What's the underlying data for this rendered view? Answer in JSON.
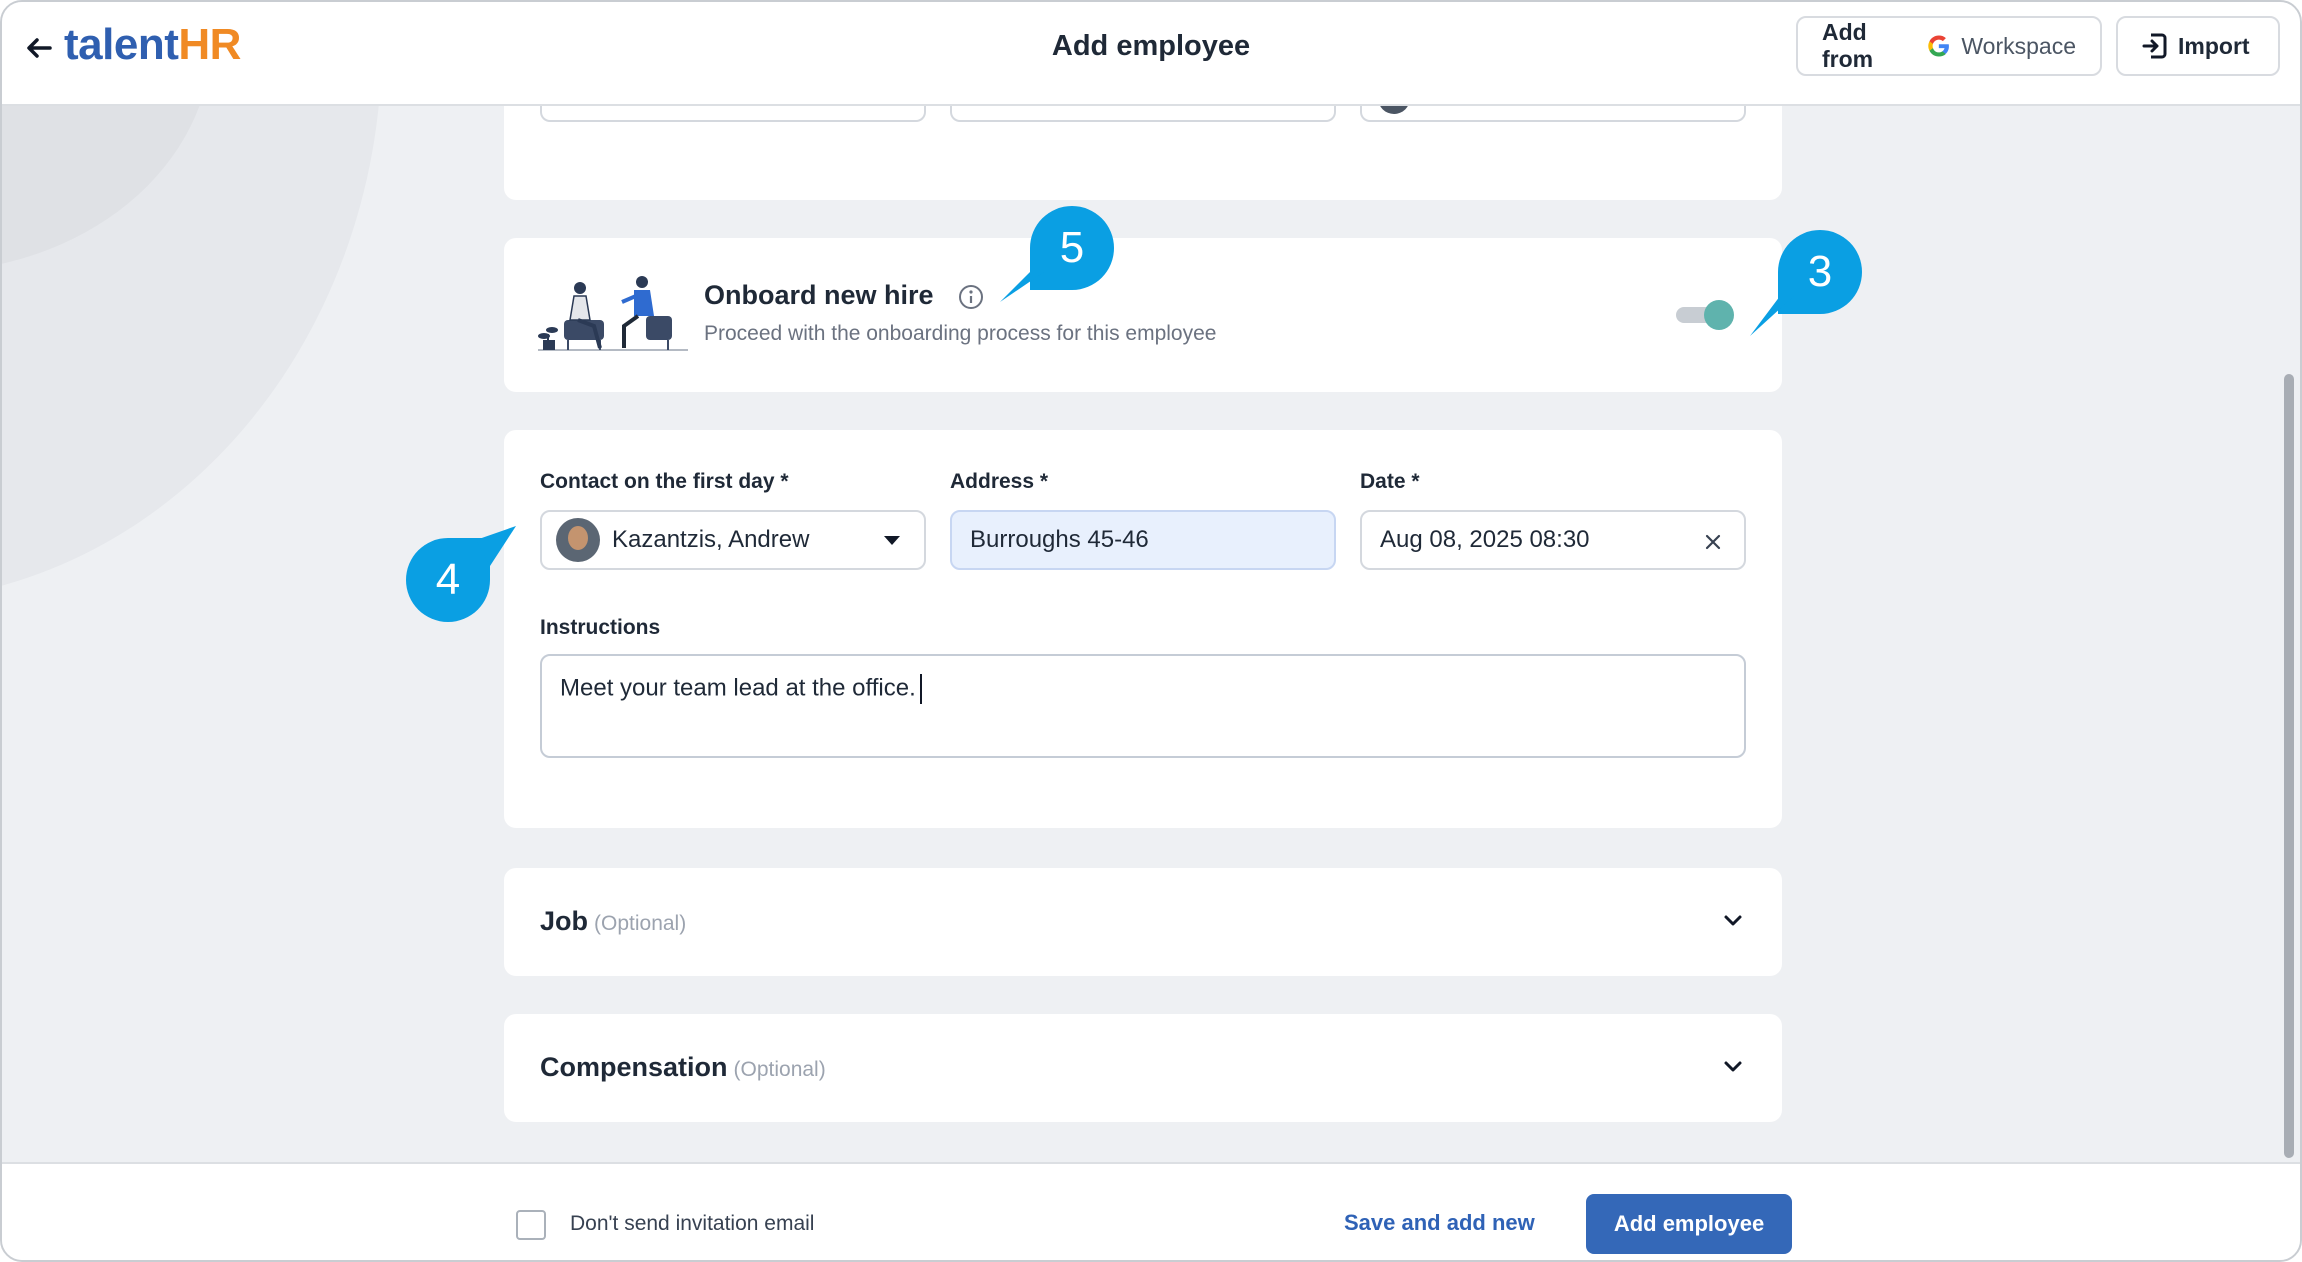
{
  "header": {
    "logo_talent": "talent",
    "logo_hr": "HR",
    "title": "Add employee",
    "add_from_label": "Add from",
    "workspace_label": "Workspace",
    "import_label": "Import"
  },
  "onboard": {
    "title": "Onboard new hire",
    "subtitle": "Proceed with the onboarding process for this employee",
    "toggle_on": true
  },
  "form": {
    "contact_label": "Contact on the first day *",
    "contact_value": "Kazantzis, Andrew",
    "address_label": "Address *",
    "address_value": "Burroughs 45-46",
    "date_label": "Date *",
    "date_value": "Aug 08, 2025 08:30",
    "instructions_label": "Instructions",
    "instructions_value": "Meet your team lead at the office."
  },
  "sections": {
    "job_title": "Job",
    "job_optional": "(Optional)",
    "comp_title": "Compensation",
    "comp_optional": "(Optional)"
  },
  "footer": {
    "checkbox_label": "Don't send invitation email",
    "save_and_add_new": "Save and add new",
    "add_employee": "Add employee"
  },
  "callouts": {
    "c3": "3",
    "c4": "4",
    "c5": "5"
  },
  "colors": {
    "brand_blue": "#2f5fb0",
    "brand_orange": "#f08a24",
    "primary_button": "#3468b8",
    "callout": "#0a9fe3",
    "toggle_knob": "#5fb3ad"
  }
}
